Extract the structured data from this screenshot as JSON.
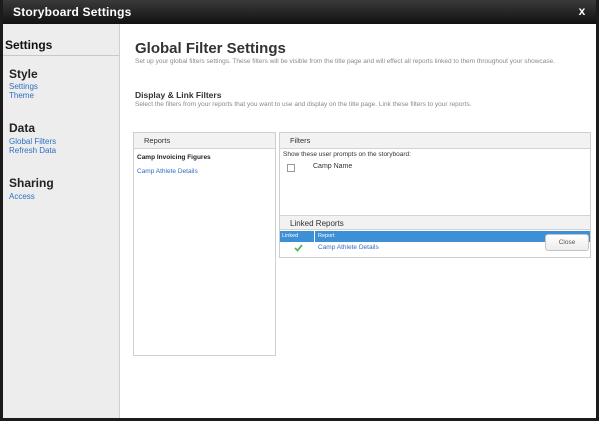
{
  "window": {
    "title": "Storyboard Settings",
    "close_label": "x"
  },
  "sidebar": {
    "heading": "Settings",
    "sections": [
      {
        "title": "Style",
        "links": [
          "Settings",
          "Theme"
        ]
      },
      {
        "title": "Data",
        "links": [
          "Global Filters",
          "Refresh Data"
        ]
      },
      {
        "title": "Sharing",
        "links": [
          "Access"
        ]
      }
    ]
  },
  "main": {
    "title": "Global Filter Settings",
    "description": "Set up your global filters settings. These filters will be visible from the title page and will effect all reports linked to them throughout your showcase.",
    "subtitle": "Display & Link Filters",
    "subdescription": "Select the filters from your reports that you want to use and display on the title page. Link these filters to your reports.",
    "reports_panel": {
      "header": "Reports",
      "items": [
        "Camp Invoicing Figures",
        "Camp Athlete Details"
      ]
    },
    "filters_panel": {
      "header": "Filters",
      "prompt": "Show these user prompts on the storyboard:",
      "filter_name": "Camp Name",
      "linked_header": "Linked Reports",
      "columns": [
        "Linked",
        "Report"
      ],
      "linked_rows": [
        {
          "report": "Camp Athlete Details"
        }
      ]
    },
    "close_button": "Close"
  },
  "colors": {
    "link": "#2e6fc4",
    "table_header": "#3d8fd6",
    "check": "#5cb85c"
  }
}
